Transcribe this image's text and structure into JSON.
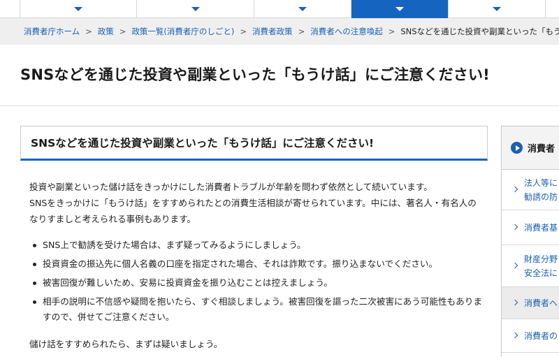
{
  "nav": {
    "tabs": [
      {
        "active": false
      },
      {
        "active": false
      },
      {
        "active": false
      },
      {
        "active": true
      },
      {
        "active": false
      }
    ]
  },
  "breadcrumb": {
    "items": [
      "消費者庁ホーム",
      "政策",
      "政策一覧(消費者庁のしごと)",
      "消費者政策",
      "消費者への注意喚起"
    ],
    "current": "SNSなどを通じた投資や副業といった「もうけ話",
    "separator": ">"
  },
  "page_title": "SNSなどを通じた投資や副業といった「もうけ話」にご注意ください!",
  "article": {
    "heading": "SNSなどを通じた投資や副業といった「もうけ話」にご注意ください!",
    "intro": [
      "投資や副業といった儲け話をきっかけにした消費者トラブルが年齢を問わず依然として続いています。",
      "SNSをきっかけに「もうけ話」をすすめられたとの消費生活相談が寄せられています。中には、著名人・有名人のなりすましと考えられる事例もあります。"
    ],
    "bullets": [
      "SNS上で勧誘を受けた場合は、まず疑ってみるようにしましょう。",
      "投資資金の振込先に個人名義の口座を指定された場合、それは詐欺です。振り込まないでください。",
      "被害回復が難しいため、安易に投資資金を振り込むことは控えましょう。",
      "相手の説明に不信感や疑問を抱いたら、すぐ相談しましょう。被害回復を謳った二次被害にあう可能性もありますので、併せてご注意ください。"
    ],
    "closing": "儲け話をすすめられたら、まずは疑いましょう。"
  },
  "sidebar": {
    "heading": "消費者",
    "items": [
      {
        "lines": [
          "法人等に",
          "勧誘の防"
        ],
        "selected": false
      },
      {
        "lines": [
          "消費者基"
        ],
        "selected": false
      },
      {
        "lines": [
          "財産分野",
          "安全法に"
        ],
        "selected": false
      },
      {
        "lines": [
          "消費者へ"
        ],
        "selected": true
      },
      {
        "lines": [
          "消費者の"
        ],
        "selected": false
      }
    ]
  },
  "colors": {
    "accent": "#1565c0",
    "link": "#1a5fb4",
    "breadcrumb_bg": "#efefef"
  }
}
